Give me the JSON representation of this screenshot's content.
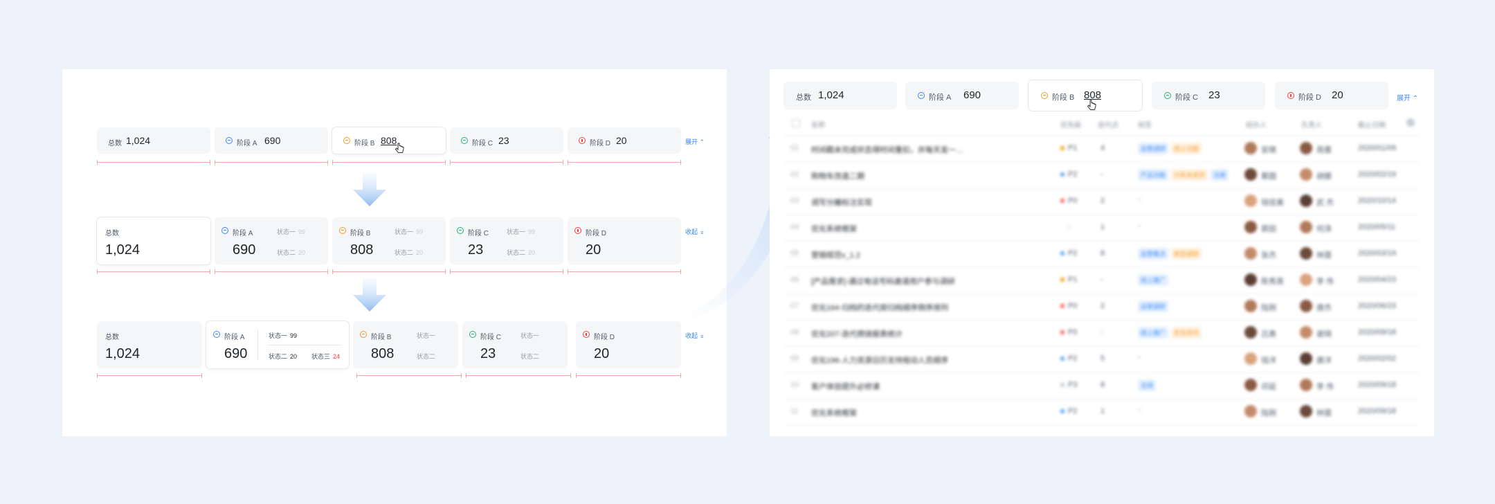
{
  "cards": {
    "total_label": "总数",
    "total_value": "1,024",
    "stages": [
      {
        "label": "阶段 A",
        "value": "690",
        "color": "#3a86f3"
      },
      {
        "label": "阶段 B",
        "value": "808",
        "color": "#f59a23"
      },
      {
        "label": "阶段 C",
        "value": "23",
        "color": "#23b27a"
      },
      {
        "label": "阶段 D",
        "value": "20",
        "color": "#f53f3f"
      }
    ],
    "sub_status_1": "状态一",
    "sub_status_2": "状态二",
    "sub_status_3": "状态三",
    "sub_value_99": "99",
    "sub_value_20": "20",
    "sub_value_24": "24",
    "expand": "展开",
    "collapse": "收起"
  },
  "table": {
    "headers": [
      "名称",
      "优先级",
      "迭代点",
      "标签",
      "经办人",
      "负责人",
      "截止日期"
    ],
    "rows": [
      {
        "name": "时间戳未完成状态得时间重扣，并每天发一…",
        "prio": "P1",
        "points": "4",
        "tags": [
          "运营调研",
          "线上功能"
        ],
        "assignee": "安晓",
        "owner": "周墨",
        "date": "2020/01/09"
      },
      {
        "name": "购物车改造二期",
        "prio": "P2",
        "points": "-",
        "tags": [
          "产品功能",
          "分析未来员",
          "注册"
        ],
        "assignee": "蔡圆",
        "owner": "胡娜",
        "date": "2020/02/19"
      },
      {
        "name": "调写分離标注实现",
        "prio": "P0",
        "points": "2",
        "tags": [
          "-"
        ],
        "assignee": "钱佳美",
        "owner": "武 杰",
        "date": "2020/10/14"
      },
      {
        "name": "优化系统框架",
        "prio": "-",
        "points": "1",
        "tags": [
          "-"
        ],
        "assignee": "郭田",
        "owner": "何泽",
        "date": "2020/05/11"
      },
      {
        "name": "营销规范v_1.2",
        "prio": "P2",
        "points": "8",
        "tags": [
          "运营重点",
          "新促调研"
        ],
        "assignee": "张杰",
        "owner": "林茵",
        "date": "2020/03/19"
      },
      {
        "name": "[产品需求]-通过电话号码邀请用户参与调研",
        "prio": "P1",
        "points": "-",
        "tags": [
          "线上推广"
        ],
        "assignee": "陈秀英",
        "owner": "李 伟",
        "date": "2020/04/23"
      },
      {
        "name": "优化164-归档的迭代按归档顺序倒序排列",
        "prio": "P0",
        "points": "2",
        "tags": [
          "运营调研"
        ],
        "assignee": "陆刚",
        "owner": "唐杰",
        "date": "2020/06/23"
      },
      {
        "name": "优化207-迭代燃烧报表统计",
        "prio": "P0",
        "points": "-",
        "tags": [
          "线上推广",
          "优先迭代"
        ],
        "assignee": "吕勇",
        "owner": "谢琦",
        "date": "2020/09/18"
      },
      {
        "name": "优化196-人力资源日历支持拖动人员顺序",
        "prio": "P2",
        "points": "5",
        "tags": [
          "-"
        ],
        "assignee": "钱洋",
        "owner": "唐洋",
        "date": "2020/02/02"
      },
      {
        "name": "客户体验提升必修课",
        "prio": "P3",
        "points": "8",
        "tags": [
          "主线"
        ],
        "assignee": "邓延",
        "owner": "李 伟",
        "date": "2020/09/18"
      },
      {
        "name": "优化系统框架",
        "prio": "P2",
        "points": "1",
        "tags": [
          "-"
        ],
        "assignee": "陆刚",
        "owner": "林茵",
        "date": "2020/09/18"
      }
    ]
  }
}
